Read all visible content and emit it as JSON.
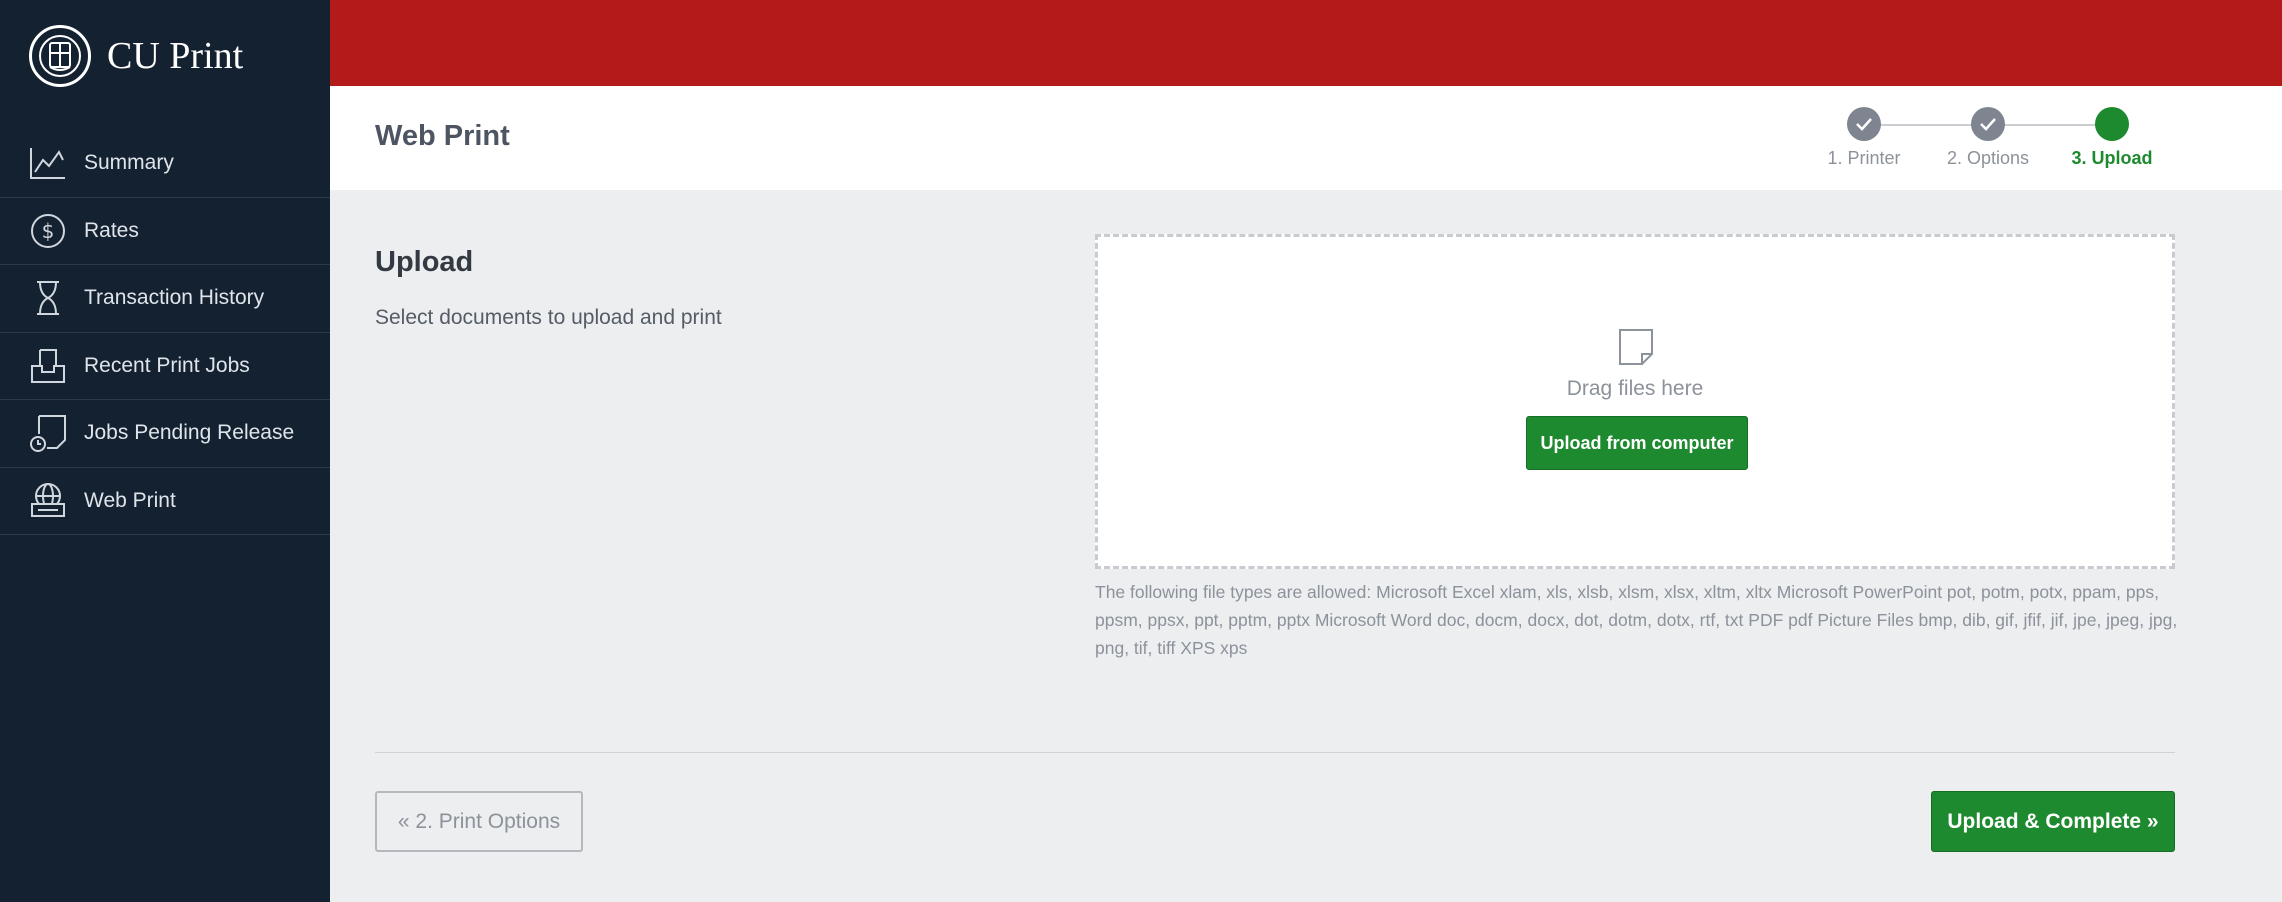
{
  "brand": {
    "name": "CU Print",
    "logo_icon": "cornell-seal-icon"
  },
  "sidebar": {
    "items": [
      {
        "label": "Summary",
        "icon": "line-chart-icon"
      },
      {
        "label": "Rates",
        "icon": "dollar-circle-icon"
      },
      {
        "label": "Transaction History",
        "icon": "hourglass-icon"
      },
      {
        "label": "Recent Print Jobs",
        "icon": "print-tray-icon"
      },
      {
        "label": "Jobs Pending Release",
        "icon": "document-clock-icon"
      },
      {
        "label": "Web Print",
        "icon": "globe-printer-icon"
      }
    ]
  },
  "header": {
    "title": "Web Print",
    "steps": [
      {
        "label": "1. Printer",
        "state": "done"
      },
      {
        "label": "2. Options",
        "state": "done"
      },
      {
        "label": "3. Upload",
        "state": "active"
      }
    ]
  },
  "main": {
    "heading": "Upload",
    "subheading": "Select documents to upload and print",
    "dropzone": {
      "drag_text": "Drag files here",
      "button_label": "Upload from computer"
    },
    "filetypes_text": "The following file types are allowed: Microsoft Excel xlam, xls, xlsb, xlsm, xlsx, xltm, xltx Microsoft PowerPoint pot, potm, potx, ppam, pps, ppsm, ppsx, ppt, pptm, pptx Microsoft Word doc, docm, docx, dot, dotm, dotx, rtf, txt PDF pdf Picture Files bmp, dib, gif, jfif, jif, jpe, jpeg, jpg, png, tif, tiff XPS xps",
    "back_button": "« 2. Print Options",
    "complete_button": "Upload & Complete »"
  },
  "colors": {
    "sidebar_bg": "#142130",
    "topbar_red": "#b31b1b",
    "accent_green": "#1e8a2f",
    "content_bg": "#eceef0"
  }
}
